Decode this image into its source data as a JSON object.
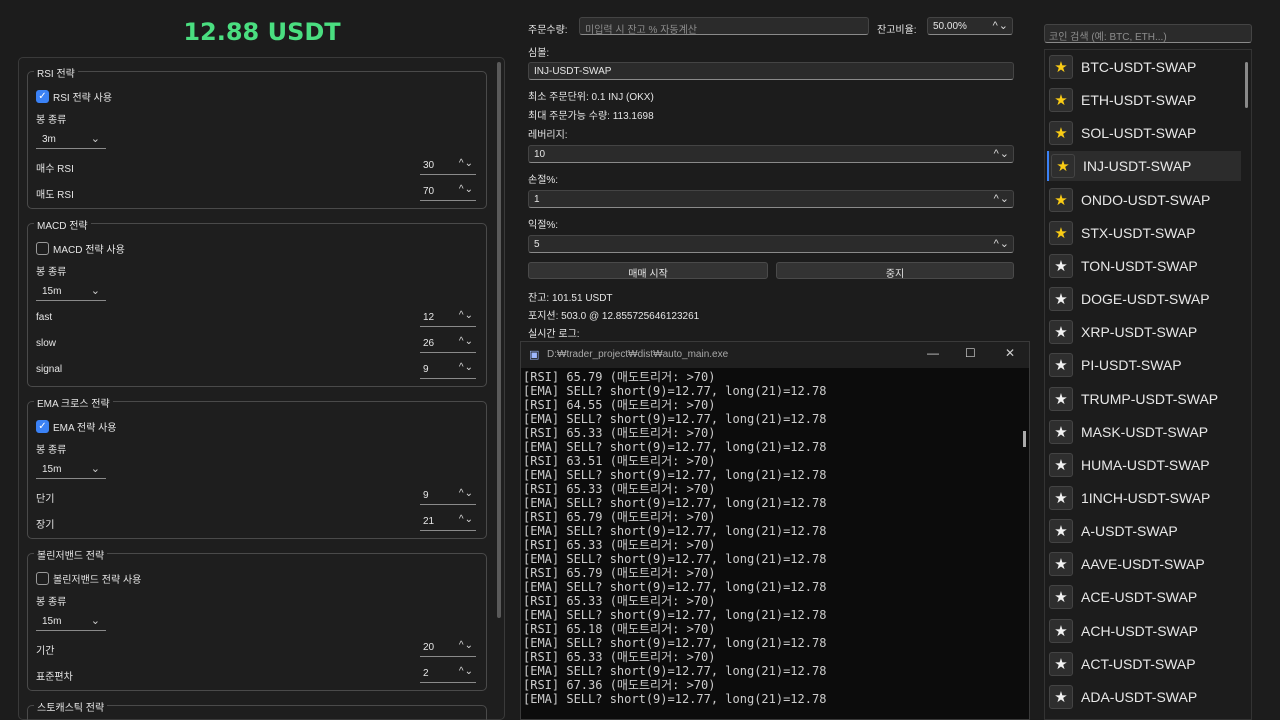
{
  "balance_title": "12.88 USDT",
  "strategies": {
    "rsi": {
      "title": "RSI 전략",
      "enable_label": "RSI 전략 사용",
      "enabled": true,
      "candle_label": "봉 종류",
      "candle": "3m",
      "params": [
        {
          "label": "매수 RSI",
          "value": "30"
        },
        {
          "label": "매도 RSI",
          "value": "70"
        }
      ]
    },
    "macd": {
      "title": "MACD 전략",
      "enable_label": "MACD 전략 사용",
      "enabled": false,
      "candle_label": "봉 종류",
      "candle": "15m",
      "params": [
        {
          "label": "fast",
          "value": "12"
        },
        {
          "label": "slow",
          "value": "26"
        },
        {
          "label": "signal",
          "value": "9"
        }
      ]
    },
    "ema": {
      "title": "EMA 크로스 전략",
      "enable_label": "EMA 전략 사용",
      "enabled": true,
      "candle_label": "봉 종류",
      "candle": "15m",
      "params": [
        {
          "label": "단기",
          "value": "9"
        },
        {
          "label": "장기",
          "value": "21"
        }
      ]
    },
    "bollinger": {
      "title": "볼린저밴드 전략",
      "enable_label": "볼린저밴드 전략 사용",
      "enabled": false,
      "candle_label": "봉 종류",
      "candle": "15m",
      "params": [
        {
          "label": "기간",
          "value": "20"
        },
        {
          "label": "표준편차",
          "value": "2"
        }
      ]
    },
    "stochastic": {
      "title": "스토캐스틱 전략"
    }
  },
  "order": {
    "qty_label": "주문수량:",
    "qty_placeholder": "미입력 시 잔고 % 자동계산",
    "ratio_label": "잔고비율:",
    "ratio_value": "50.00%",
    "symbol_label": "심볼:",
    "symbol_value": "INJ-USDT-SWAP",
    "min_unit": "최소 주문단위: 0.1 INJ (OKX)",
    "max_qty": "최대 주문가능 수량: 113.1698",
    "leverage_label": "레버리지:",
    "leverage_value": "10",
    "stoploss_label": "손절%:",
    "stoploss_value": "1",
    "takeprofit_label": "익절%:",
    "takeprofit_value": "5",
    "start_button": "매매 시작",
    "stop_button": "중지",
    "balance_text": "잔고: 101.51 USDT",
    "position_text": "포지션: 503.0 @ 12.855725646123261",
    "log_label": "실시간 로그:"
  },
  "console": {
    "title": "D:₩trader_project₩dist₩auto_main.exe",
    "lines": [
      "[RSI] 65.79 (매도트리거: >70)",
      "[EMA] SELL? short(9)=12.77, long(21)=12.78",
      "[RSI] 64.55 (매도트리거: >70)",
      "[EMA] SELL? short(9)=12.77, long(21)=12.78",
      "[RSI] 65.33 (매도트리거: >70)",
      "[EMA] SELL? short(9)=12.77, long(21)=12.78",
      "[RSI] 63.51 (매도트리거: >70)",
      "[EMA] SELL? short(9)=12.77, long(21)=12.78",
      "[RSI] 65.33 (매도트리거: >70)",
      "[EMA] SELL? short(9)=12.77, long(21)=12.78",
      "[RSI] 65.79 (매도트리거: >70)",
      "[EMA] SELL? short(9)=12.77, long(21)=12.78",
      "[RSI] 65.33 (매도트리거: >70)",
      "[EMA] SELL? short(9)=12.77, long(21)=12.78",
      "[RSI] 65.79 (매도트리거: >70)",
      "[EMA] SELL? short(9)=12.77, long(21)=12.78",
      "[RSI] 65.33 (매도트리거: >70)",
      "[EMA] SELL? short(9)=12.77, long(21)=12.78",
      "[RSI] 65.18 (매도트리거: >70)",
      "[EMA] SELL? short(9)=12.77, long(21)=12.78",
      "[RSI] 65.33 (매도트리거: >70)",
      "[EMA] SELL? short(9)=12.77, long(21)=12.78",
      "[RSI] 67.36 (매도트리거: >70)",
      "[EMA] SELL? short(9)=12.77, long(21)=12.78"
    ]
  },
  "coin_search_placeholder": "코인 검색 (예: BTC, ETH...)",
  "coins": [
    {
      "name": "BTC-USDT-SWAP",
      "fav": true
    },
    {
      "name": "ETH-USDT-SWAP",
      "fav": true
    },
    {
      "name": "SOL-USDT-SWAP",
      "fav": true
    },
    {
      "name": "INJ-USDT-SWAP",
      "fav": true,
      "selected": true
    },
    {
      "name": "ONDO-USDT-SWAP",
      "fav": true
    },
    {
      "name": "STX-USDT-SWAP",
      "fav": true
    },
    {
      "name": "TON-USDT-SWAP",
      "fav": false
    },
    {
      "name": "DOGE-USDT-SWAP",
      "fav": false
    },
    {
      "name": "XRP-USDT-SWAP",
      "fav": false
    },
    {
      "name": "PI-USDT-SWAP",
      "fav": false
    },
    {
      "name": "TRUMP-USDT-SWAP",
      "fav": false
    },
    {
      "name": "MASK-USDT-SWAP",
      "fav": false
    },
    {
      "name": "HUMA-USDT-SWAP",
      "fav": false
    },
    {
      "name": "1INCH-USDT-SWAP",
      "fav": false
    },
    {
      "name": "A-USDT-SWAP",
      "fav": false
    },
    {
      "name": "AAVE-USDT-SWAP",
      "fav": false
    },
    {
      "name": "ACE-USDT-SWAP",
      "fav": false
    },
    {
      "name": "ACH-USDT-SWAP",
      "fav": false
    },
    {
      "name": "ACT-USDT-SWAP",
      "fav": false
    },
    {
      "name": "ADA-USDT-SWAP",
      "fav": false
    }
  ],
  "colors": {
    "accent": "#3b82f6",
    "balance_green": "#4ade80",
    "favorite_star": "#facc15"
  }
}
